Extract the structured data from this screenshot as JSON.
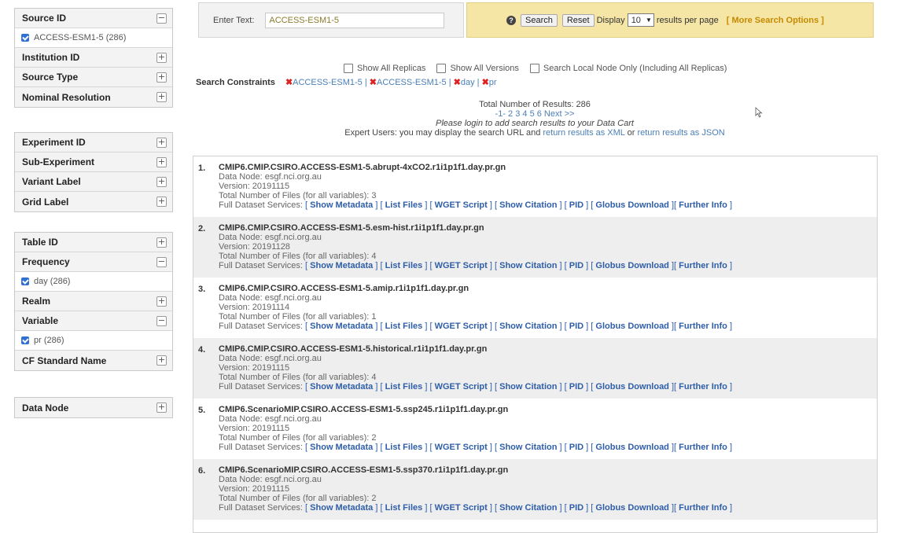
{
  "sidebar": {
    "group1": {
      "source_id": {
        "title": "Source ID",
        "toggle": "−",
        "selected": "ACCESS-ESM1-5 (286)"
      },
      "items": [
        {
          "title": "Institution ID",
          "toggle": "+"
        },
        {
          "title": "Source Type",
          "toggle": "+"
        },
        {
          "title": "Nominal Resolution",
          "toggle": "+"
        }
      ]
    },
    "group2": {
      "items": [
        {
          "title": "Experiment ID",
          "toggle": "+"
        },
        {
          "title": "Sub-Experiment",
          "toggle": "+"
        },
        {
          "title": "Variant Label",
          "toggle": "+"
        },
        {
          "title": "Grid Label",
          "toggle": "+"
        }
      ]
    },
    "group3": {
      "table_id": {
        "title": "Table ID",
        "toggle": "+"
      },
      "frequency": {
        "title": "Frequency",
        "toggle": "−",
        "selected": "day (286)"
      },
      "realm": {
        "title": "Realm",
        "toggle": "+"
      },
      "variable": {
        "title": "Variable",
        "toggle": "−",
        "selected": "pr (286)"
      },
      "cf_standard_name": {
        "title": "CF Standard Name",
        "toggle": "+"
      }
    },
    "group4": {
      "data_node": {
        "title": "Data Node",
        "toggle": "+"
      }
    }
  },
  "search": {
    "label": "Enter Text:",
    "value": "ACCESS-ESM1-5",
    "help_icon": "?",
    "search_button": "Search",
    "reset_button": "Reset",
    "display_label": "Display",
    "per_page": "10",
    "per_page_suffix": "results per page",
    "more_options": "[ More Search Options ]"
  },
  "options": {
    "show_all_replicas": "Show All Replicas",
    "show_all_versions": "Show All Versions",
    "search_local": "Search Local Node Only (Including All Replicas)"
  },
  "constraints": {
    "label": "Search Constraints",
    "items": [
      "ACCESS-ESM1-5 |",
      "ACCESS-ESM1-5 |",
      "day |",
      "pr"
    ]
  },
  "summary": {
    "total": "Total Number of Results: 286",
    "pager": "-1- 2 3 4 5 6 Next >>",
    "login_note": "Please login to add search results to your Data Cart",
    "expert_prefix": "Expert Users: you may display the search URL and",
    "xml_link": "return results as XML",
    "or": "or",
    "json_link": "return results as JSON"
  },
  "services": {
    "prefix": "Full Dataset Services:",
    "show_metadata": "Show Metadata",
    "list_files": "List Files",
    "wget_script": "WGET Script",
    "show_citation": "Show Citation",
    "pid": "PID",
    "globus_download": "Globus Download",
    "further_info": "Further Info"
  },
  "results": [
    {
      "num": "1.",
      "title": "CMIP6.CMIP.CSIRO.ACCESS-ESM1-5.abrupt-4xCO2.r1i1p1f1.day.pr.gn",
      "node": "Data Node: esgf.nci.org.au",
      "version": "Version: 20191115",
      "files": "Total Number of Files (for all variables): 3"
    },
    {
      "num": "2.",
      "title": "CMIP6.CMIP.CSIRO.ACCESS-ESM1-5.esm-hist.r1i1p1f1.day.pr.gn",
      "node": "Data Node: esgf.nci.org.au",
      "version": "Version: 20191128",
      "files": "Total Number of Files (for all variables): 4"
    },
    {
      "num": "3.",
      "title": "CMIP6.CMIP.CSIRO.ACCESS-ESM1-5.amip.r1i1p1f1.day.pr.gn",
      "node": "Data Node: esgf.nci.org.au",
      "version": "Version: 20191114",
      "files": "Total Number of Files (for all variables): 1"
    },
    {
      "num": "4.",
      "title": "CMIP6.CMIP.CSIRO.ACCESS-ESM1-5.historical.r1i1p1f1.day.pr.gn",
      "node": "Data Node: esgf.nci.org.au",
      "version": "Version: 20191115",
      "files": "Total Number of Files (for all variables): 4"
    },
    {
      "num": "5.",
      "title": "CMIP6.ScenarioMIP.CSIRO.ACCESS-ESM1-5.ssp245.r1i1p1f1.day.pr.gn",
      "node": "Data Node: esgf.nci.org.au",
      "version": "Version: 20191115",
      "files": "Total Number of Files (for all variables): 2"
    },
    {
      "num": "6.",
      "title": "CMIP6.ScenarioMIP.CSIRO.ACCESS-ESM1-5.ssp370.r1i1p1f1.day.pr.gn",
      "node": "Data Node: esgf.nci.org.au",
      "version": "Version: 20191115",
      "files": "Total Number of Files (for all variables): 2"
    }
  ]
}
